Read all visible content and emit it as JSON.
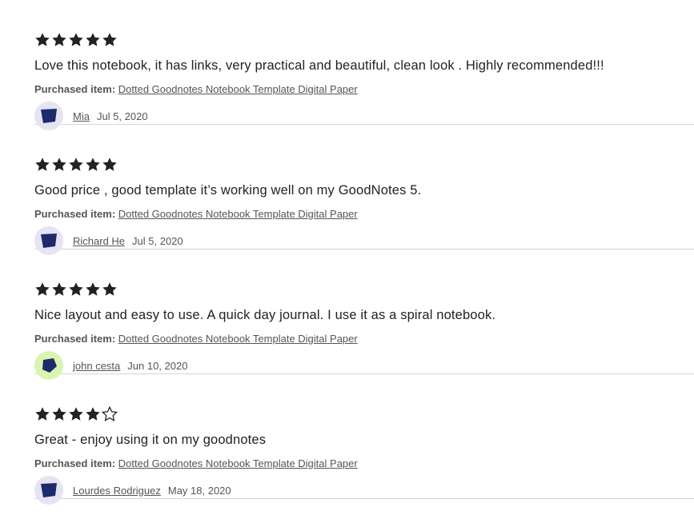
{
  "reviews": [
    {
      "rating": 5,
      "text": "Love this notebook, it has links, very practical and beautiful, clean look . Highly recommended!!!",
      "purchased_label": "Purchased item:",
      "purchased_item": "Dotted Goodnotes Notebook Template Digital Paper",
      "reviewer": "Mia",
      "date": "Jul 5, 2020",
      "avatar_bg": "#e6e3f2",
      "avatar_fg": "#1d2a6b"
    },
    {
      "rating": 5,
      "text": "Good price , good template it’s working well on my GoodNotes 5.",
      "purchased_label": "Purchased item:",
      "purchased_item": "Dotted Goodnotes Notebook Template Digital Paper",
      "reviewer": "Richard He",
      "date": "Jul 5, 2020",
      "avatar_bg": "#e6e3f2",
      "avatar_fg": "#1d2a6b"
    },
    {
      "rating": 5,
      "text": "Nice layout and easy to use. A quick day journal. I use it as a spiral notebook.",
      "purchased_label": "Purchased item:",
      "purchased_item": "Dotted Goodnotes Notebook Template Digital Paper",
      "reviewer": "john cesta",
      "date": "Jun 10, 2020",
      "avatar_bg": "#d9f5b0",
      "avatar_fg": "#1d2a6b"
    },
    {
      "rating": 4,
      "text": "Great - enjoy using it on my goodnotes",
      "purchased_label": "Purchased item:",
      "purchased_item": "Dotted Goodnotes Notebook Template Digital Paper",
      "reviewer": "Lourdes Rodriguez",
      "date": "May 18, 2020",
      "avatar_bg": "#e6e3f2",
      "avatar_fg": "#1d2a6b"
    }
  ],
  "max_rating": 5,
  "colors": {
    "star": "#222222",
    "divider": "#d6d6d6",
    "text": "#222222",
    "muted": "#555555"
  },
  "icons": {
    "star_filled": "star-filled-icon",
    "star_empty": "star-outline-icon",
    "avatar": "user-avatar-icon"
  }
}
